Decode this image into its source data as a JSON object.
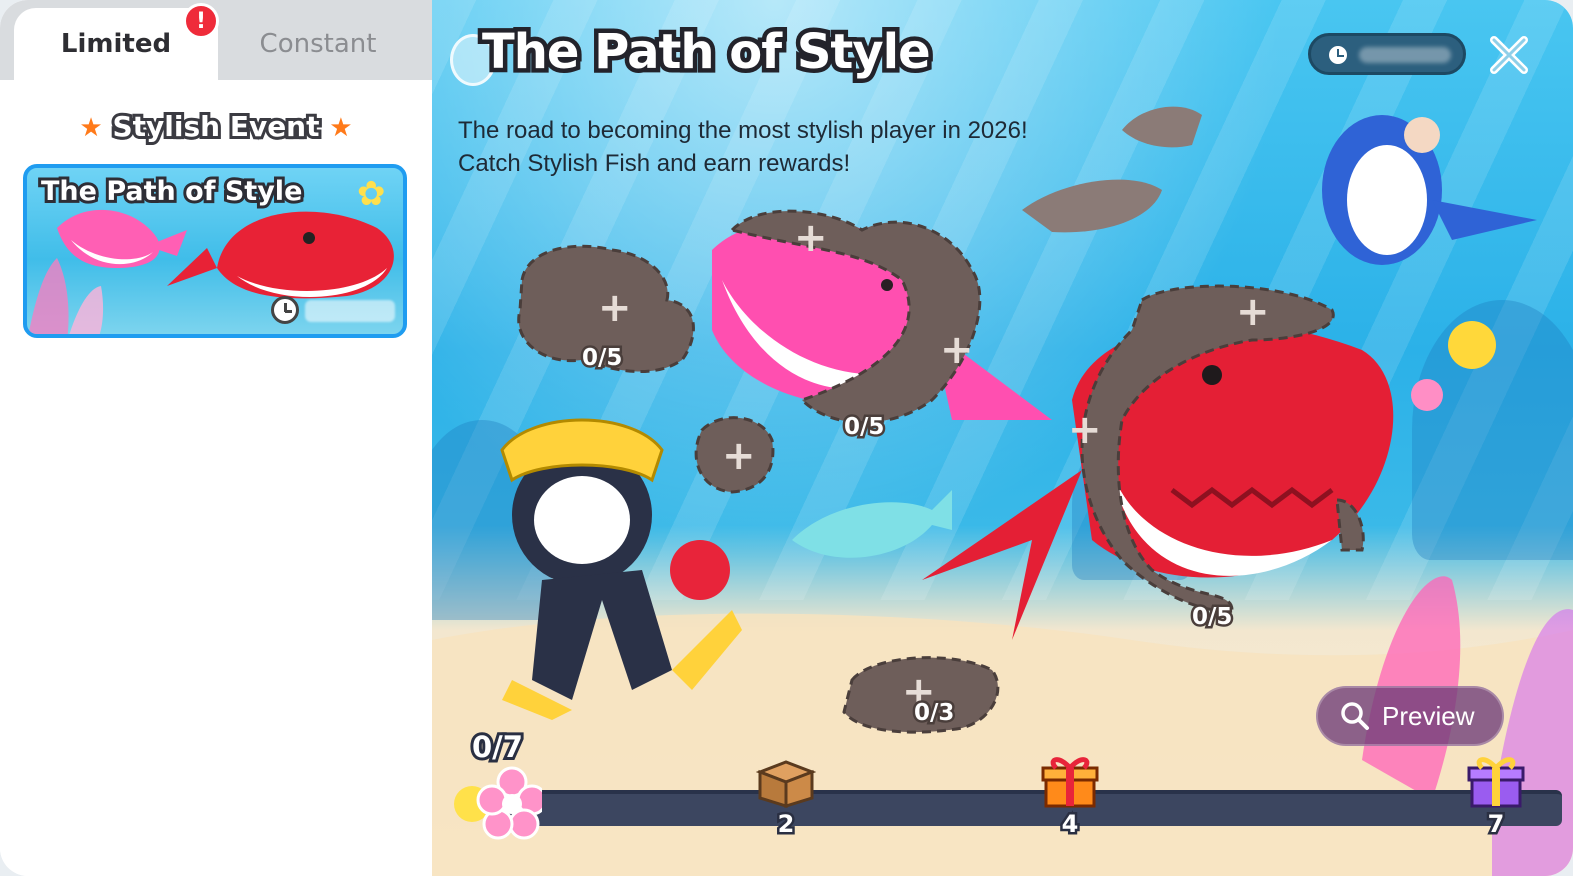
{
  "sidebar": {
    "tabs": [
      {
        "label": "Limited",
        "active": true,
        "has_alert": true,
        "alert_symbol": "!"
      },
      {
        "label": "Constant",
        "active": false
      }
    ],
    "section_title": "Stylish Event",
    "event_card": {
      "title": "The Path of Style",
      "icon": "clock-icon"
    }
  },
  "main": {
    "title": "The Path of Style",
    "description_lines": [
      "The road to becoming the most stylish player in 2026!",
      "Catch Stylish Fish and earn rewards!"
    ],
    "timer_icon": "clock-icon",
    "close_icon": "close-icon",
    "silhouettes": [
      {
        "name": "silhouette-1",
        "progress": "0/5"
      },
      {
        "name": "silhouette-2",
        "progress": "0/5"
      },
      {
        "name": "silhouette-3",
        "progress": "0/5"
      },
      {
        "name": "silhouette-4",
        "progress": ""
      },
      {
        "name": "silhouette-5",
        "progress": "0/3"
      }
    ],
    "preview_button": {
      "label": "Preview",
      "icon": "search-icon"
    },
    "progress": {
      "count": "0/7",
      "current": 0,
      "total": 7,
      "milestones": [
        {
          "value": "2",
          "reward_icon": "box-icon"
        },
        {
          "value": "4",
          "reward_icon": "gift-icon"
        },
        {
          "value": "7",
          "reward_icon": "gift-icon"
        }
      ]
    }
  },
  "colors": {
    "accent_blue": "#1f9cf0",
    "alert_red": "#ef2b3a",
    "star_orange": "#ff7a1a",
    "progress_track": "#3c4660"
  }
}
